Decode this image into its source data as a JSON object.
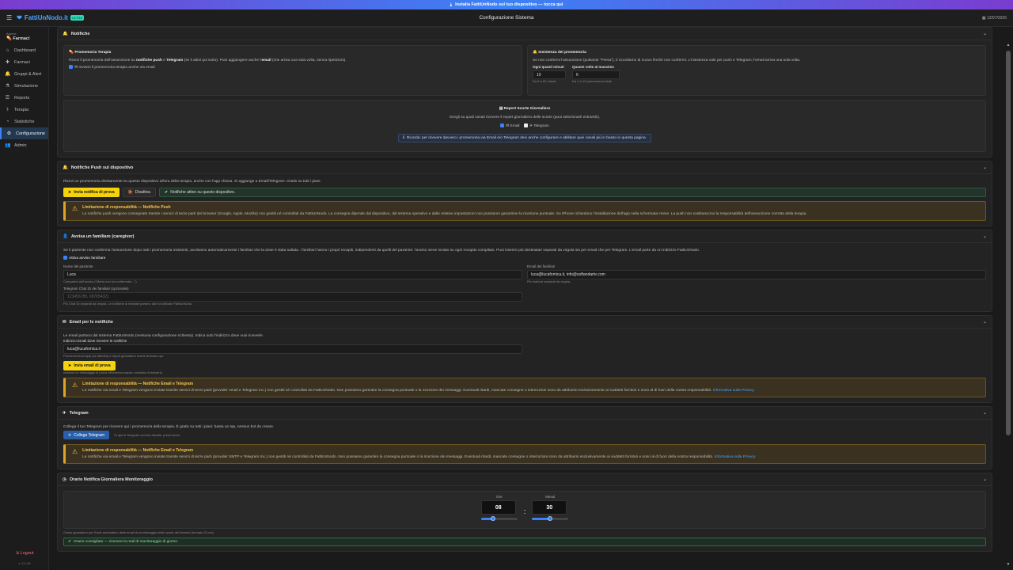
{
  "banner": {
    "text": "Installa FattiUnNodo sul tuo dispositivo — tocca qui"
  },
  "topbar": {
    "brand": "FattiUnNodo.it",
    "badge": "ULTRA",
    "title": "Configurazione Sistema",
    "date": "12/07/2026"
  },
  "sidebar": {
    "context_label": "Agente",
    "context_value": "Farmaci",
    "items": [
      {
        "icon": "⌂",
        "label": "Dashboard"
      },
      {
        "icon": "✚",
        "label": "Farmaci"
      },
      {
        "icon": "🔔",
        "label": "Gruppi & Alert"
      },
      {
        "icon": "⚗",
        "label": "Simulazione"
      },
      {
        "icon": "☰",
        "label": "Reports"
      },
      {
        "icon": "⚕",
        "label": "Terapia"
      },
      {
        "icon": "◔",
        "label": "Statistiche"
      },
      {
        "icon": "⚙",
        "label": "Configurazione"
      },
      {
        "icon": "👥",
        "label": "Admin"
      }
    ],
    "logout": "Logout",
    "version": "v. 2.0.49"
  },
  "notifiche": {
    "title": "Notifiche",
    "promemoria": {
      "title": "Promemoria Terapia",
      "text_a": "Ricevi il promemoria dell'assunzione su ",
      "text_b": "notifiche push",
      "text_c": " e ",
      "text_d": "Telegram",
      "text_e": " (se li attivi qui sotto). Puoi aggiungere anche l'",
      "text_f": "email",
      "text_g": " (che arriva una sola volta, senza ripetizioni).",
      "check": "Inviami il promemoria terapia anche via email"
    },
    "insistenza": {
      "title": "Insistenza dei promemoria",
      "text": "Se non confermi l'assunzione (pulsante \"Presa\"), ti ricordiamo di nuovo finché non confermi. L'insistenza vale per push e Telegram; l'email arriva una sola volta.",
      "every_label": "Ogni quanti minuti",
      "every_value": "10",
      "every_hint": "Da 5 a 60 minuti.",
      "max_label": "Quante volte al massimo",
      "max_value": "6",
      "max_hint": "Da 1 a 12 promemoria totali."
    },
    "report": {
      "title": "Report Scorte Giornaliero",
      "text": "Scegli su quali canali ricevere il report giornaliero delle scorte (puoi selezionarli entrambi).",
      "email": "Email",
      "telegram": "Telegram",
      "info": "Ricorda: per ricevere davvero i promemoria via Email e/o Telegram devi anche configurare e abilitare quei canali più in basso in questa pagina."
    }
  },
  "push": {
    "title": "Notifiche Push sul dispositivo",
    "text": "Ricevi un promemoria direttamente su questo dispositivo all'ora della terapia, anche con l'app chiusa. Si aggiunge a Email/Telegram. Gratis su tutti i piani.",
    "test_btn": "Invia notifica di prova",
    "disable_btn": "Disattiva",
    "status": "Notifiche attive su questo dispositivo.",
    "warn_title": "Limitazione di responsabilità — Notifiche Push",
    "warn_text": "Le notifiche push vengono consegnate tramite i servizi di terze parti dei browser (Google, Apple, Mozilla) non gestiti né controllati da FattiUnNodo. La consegna dipende dal dispositivo, dal sistema operativo e dalle relative impostazioni non possiamo garantirne la ricezione puntuale. Su iPhone richiedono l'installazione dell'app nella schermata Home. La push non sostituiscono la responsabilità dell'assunzione corretta della terapia."
  },
  "caregiver": {
    "title": "Avvisa un familiare (caregiver)",
    "text": "Se il paziente non conferma l'assunzione dopo tutti i promemoria insistenti, avvisiamo automaticamente i familiari che la dose è stata saltata. I familiari hanno i propri recapiti, indipendenti da quelli del paziente: l'avviso viene inviato su ogni recapito compilato. Puoi inserire più destinatari separati da virgola sia per email che per Telegram. L'email parte da un indirizzo FattiUnNodo.",
    "check": "Attiva avviso familiare",
    "name_label": "Nome del paziente",
    "name_value": "Luca",
    "name_hint": "Comparirà nell'avviso (\"Mario non ha confermato...\").",
    "email_label": "Email dei familiari",
    "email_value": "luca@lucafomica.it, info@softandarte.com",
    "email_hint": "Più indirizzi separati da virgola.",
    "tg_label": "Telegram Chat ID dei familiari (opzionale)",
    "tg_placeholder": "123456789, 987654321",
    "tg_hint": "Più Chat ID separati da virgola. Le notifiche ai familiari partono dal bot ufficiale FattiUnNodo."
  },
  "email": {
    "title": "Email per le notifiche",
    "text": "Le email partono dal sistema FattiUnNodo (nessuna configurazione richiesta). Indica solo l'indirizzo dove vuoi riceverle.",
    "addr_label": "Indirizzo Email dove ricevere le notifiche",
    "addr_value": "luca@lucafomica.it",
    "addr_hint": "Promemoria terapia (se attivato) e report giornaliero scorte arrivano qui.",
    "test_btn": "Invia email di prova",
    "test_hint": "Inviamo un messaggio di prova all'indirizzo sopra: controlla di riceverlo.",
    "warn_title": "Limitazione di responsabilità — Notifiche Email e Telegram",
    "warn_text": "Le notifiche via email e Telegram vengono inviate tramite servizi di terze parti (provider email e Telegram Inc.) non gestiti né controllati da FattiUnNodo. Non possiamo garantire la consegna puntuale o la ricezione dei messaggi. Eventuali ritardi, mancate consegne o interruzioni sono da attribuirsi esclusivamente ai suddetti fornitori e sono al di fuori della nostra responsabilità.",
    "warn_link": "Informativa sulla Privacy."
  },
  "telegram": {
    "title": "Telegram",
    "text": "Collega il tuo Telegram per ricevere qui i promemoria della terapia. È gratis su tutti i piani: basta un tap, nessun bot da creare.",
    "btn": "Collega Telegram",
    "btn_hint": "Si aprirà Telegram sul bot ufficiale: premi Avvia.",
    "warn_title": "Limitazione di responsabilità — Notifiche Email e Telegram",
    "warn_text": "Le notifiche via email e Telegram vengono inviate tramite servizi di terze parti (provider SMTP e Telegram Inc.) non gestiti né controllati da FattiUnNodo. Non possiamo garantire la consegna puntuale o la ricezione dei messaggi. Eventuali ritardi, mancate consegne o interruzioni sono da attribuirsi esclusivamente ai suddetti fornitori e sono al di fuori della nostra responsabilità.",
    "warn_link": "Informativa sulla Privacy."
  },
  "orario": {
    "title": "Orario Notifica Giornaliera Monitoraggio",
    "hours_label": "Ore",
    "hours_value": "08",
    "hours_fraction": 0.33,
    "min_label": "Minuti",
    "min_value": "30",
    "min_fraction": 0.5,
    "hint": "Orario giornaliero per l'invio automatico delle email di monitoraggio delle scorte dei farmaci (formato 24 ore).",
    "tip": "Orario consigliato — ricevere la mail di monitoraggio di giorno."
  }
}
